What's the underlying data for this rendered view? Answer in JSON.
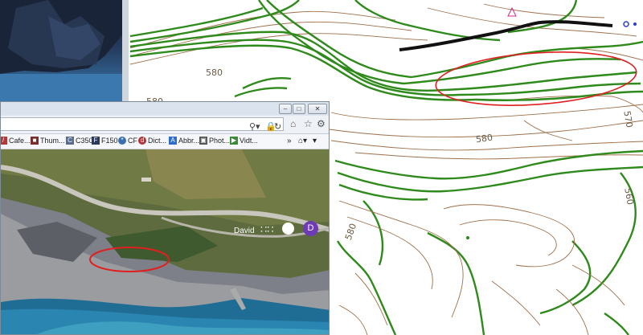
{
  "cad": {
    "contour_labels": [
      "580",
      "580",
      "570",
      "580",
      "560",
      "580"
    ]
  },
  "browser": {
    "favorites": [
      {
        "label": "Cafe...",
        "icon": "cafe-icon",
        "color": "#b03a3a"
      },
      {
        "label": "Thum...",
        "icon": "thumbnail-icon",
        "color": "#7a2d2d"
      },
      {
        "label": "C350",
        "icon": "c350-icon",
        "color": "#5a6b8c"
      },
      {
        "label": "F150",
        "icon": "f150-icon",
        "color": "#2d3a5a"
      },
      {
        "label": "CF",
        "icon": "cf-icon",
        "color": "#3a6fb0"
      },
      {
        "label": "Dict...",
        "icon": "dictionary-icon",
        "color": "#b3303a"
      },
      {
        "label": "Abbr...",
        "icon": "abbreviation-icon",
        "color": "#2e6cc8"
      },
      {
        "label": "Phot...",
        "icon": "photo-icon",
        "color": "#555555"
      },
      {
        "label": "Vidt...",
        "icon": "video-icon",
        "color": "#3a8a3a"
      }
    ],
    "user_name": "David",
    "avatar_initial": "D"
  },
  "colors": {
    "contour_green": "#2f8a1c",
    "contour_brown": "#a0704a",
    "highlight_red": "#e02020"
  }
}
